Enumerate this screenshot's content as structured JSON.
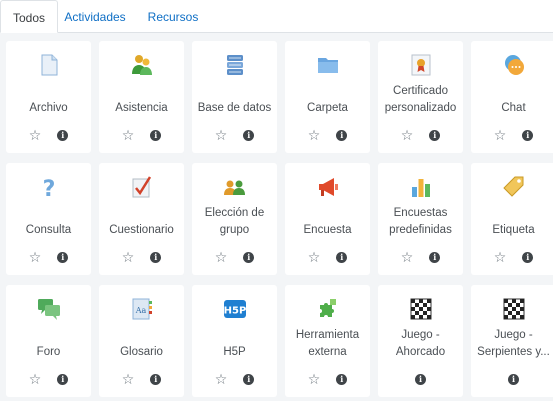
{
  "tabs": [
    {
      "label": "Todos",
      "active": true
    },
    {
      "label": "Actividades",
      "active": false
    },
    {
      "label": "Recursos",
      "active": false
    }
  ],
  "modules": [
    {
      "label": "Archivo",
      "icon": "file-icon",
      "star": true
    },
    {
      "label": "Asistencia",
      "icon": "attendance-icon",
      "star": true
    },
    {
      "label": "Base de datos",
      "icon": "database-icon",
      "star": true
    },
    {
      "label": "Carpeta",
      "icon": "folder-icon",
      "star": true
    },
    {
      "label": "Certificado personalizado",
      "icon": "certificate-icon",
      "star": true
    },
    {
      "label": "Chat",
      "icon": "chat-icon",
      "star": true
    },
    {
      "label": "Consulta",
      "icon": "question-icon",
      "star": true
    },
    {
      "label": "Cuestionario",
      "icon": "quiz-icon",
      "star": true
    },
    {
      "label": "Elección de grupo",
      "icon": "group-choice-icon",
      "star": true
    },
    {
      "label": "Encuesta",
      "icon": "megaphone-icon",
      "star": true
    },
    {
      "label": "Encuestas predefinidas",
      "icon": "bar-chart-icon",
      "star": true
    },
    {
      "label": "Etiqueta",
      "icon": "tag-icon",
      "star": true
    },
    {
      "label": "Foro",
      "icon": "forum-icon",
      "star": true
    },
    {
      "label": "Glosario",
      "icon": "glossary-icon",
      "star": true
    },
    {
      "label": "H5P",
      "icon": "h5p-icon",
      "star": true
    },
    {
      "label": "Herramienta externa",
      "icon": "puzzle-icon",
      "star": true
    },
    {
      "label": "Juego - Ahorcado",
      "icon": "checkerboard-icon",
      "star": false
    },
    {
      "label": "Juego - Serpientes y...",
      "icon": "checkerboard-icon",
      "star": false
    }
  ],
  "colors": {
    "link": "#0f6fc5",
    "background": "#f3f5f7",
    "card": "#ffffff"
  }
}
